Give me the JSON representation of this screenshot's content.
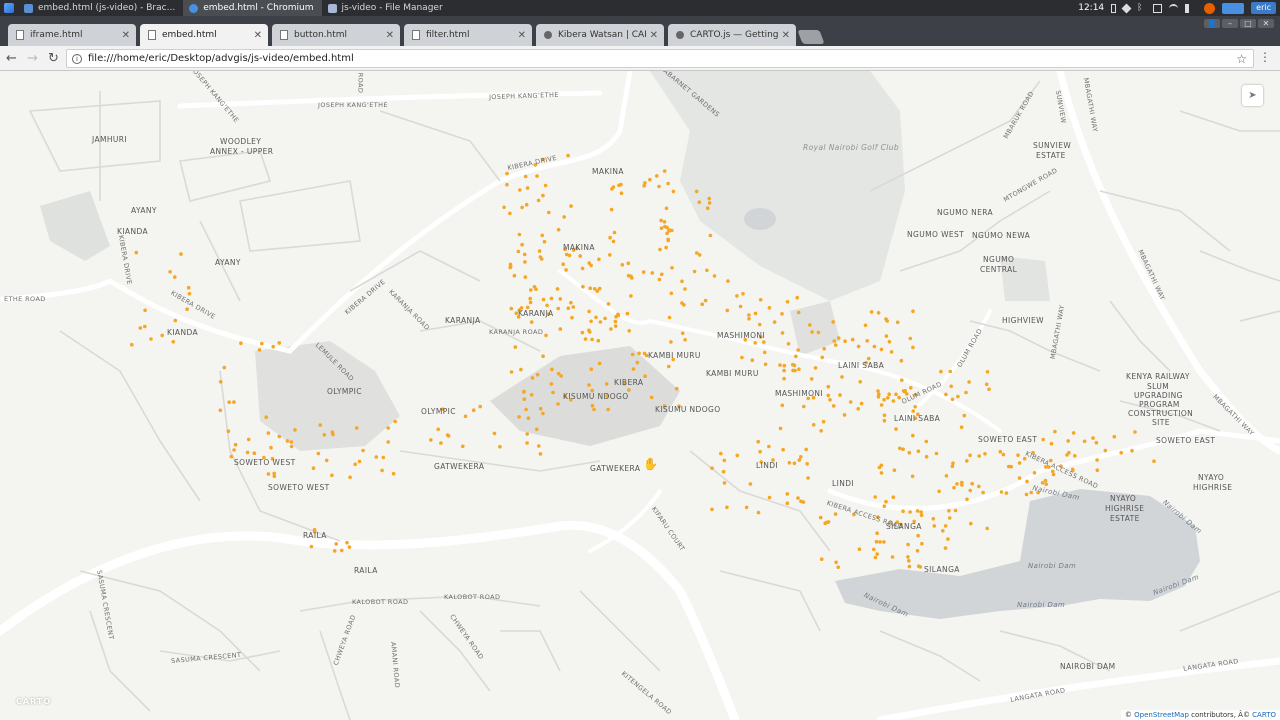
{
  "taskbar": {
    "tasks": [
      {
        "label": "embed.html (js-video) - Brac...",
        "active": false,
        "color": "#5a8fd6"
      },
      {
        "label": "embed.html - Chromium",
        "active": true,
        "color": "#4a90e2"
      },
      {
        "label": "js-video - File Manager",
        "active": false,
        "color": "#a7b7d6"
      }
    ],
    "clock": "12:14",
    "user": "eric"
  },
  "browser": {
    "tabs": [
      {
        "title": "iframe.html",
        "icon": "page-icon",
        "active": false
      },
      {
        "title": "embed.html",
        "icon": "page-icon",
        "active": true
      },
      {
        "title": "button.html",
        "icon": "page-icon",
        "active": false
      },
      {
        "title": "filter.html",
        "icon": "page-icon",
        "active": false
      },
      {
        "title": "Kibera Watsan | CARTO",
        "icon": "carto-icon",
        "active": false
      },
      {
        "title": "CARTO.js — Getting sta",
        "icon": "carto-icon",
        "active": false
      }
    ],
    "url": "file:///home/eric/Desktop/advgis/js-video/embed.html"
  },
  "map": {
    "point_color": "#f5a623",
    "labels": {
      "jamhuri": "JAMHURI",
      "woodley1": "WOODLEY",
      "woodley2": "ANNEX - UPPER",
      "ayany1": "AYANY",
      "ayany2": "AYANY",
      "kianda1": "KIANDA",
      "kianda2": "KIANDA",
      "makina1": "MAKINA",
      "makina2": "MAKINA",
      "karanja1": "KARANJA",
      "karanja2": "KARANJA",
      "olympic1": "OLYMPIC",
      "olympic2": "OLYMPIC",
      "kibera": "KIBERA",
      "kisumu1": "KISUMU NDOGO",
      "kisumu2": "KISUMU NDOGO",
      "kambi1": "KAMBI MURU",
      "kambi2": "KAMBI MURU",
      "mashimoni1": "MASHIMONI",
      "mashimoni2": "MASHIMONI",
      "lainisaba1": "LAINI SABA",
      "lainisaba2": "LAINI SABA",
      "soweto_w1": "SOWETO WEST",
      "soweto_w2": "SOWETO WEST",
      "gatwekera1": "GATWEKERA",
      "gatwekera2": "GATWEKERA",
      "lindi1": "LINDI",
      "lindi2": "LINDI",
      "silanga1": "SILANGA",
      "silanga2": "SILANGA",
      "raila1": "RAILA",
      "raila2": "RAILA",
      "soweto_e1": "SOWETO EAST",
      "soweto_e2": "SOWETO EAST",
      "ngumo_nera": "NGUMO NERA",
      "ngumo_west": "NGUMO WEST",
      "ngumo_newa": "NGUMO NEWA",
      "ngumo_central1": "NGUMO",
      "ngumo_central2": "CENTRAL",
      "highview": "HIGHVIEW",
      "sunview1": "SUNVIEW",
      "sunview2": "ESTATE",
      "kenya_rail1": "KENYA RAILWAY",
      "kenya_rail2": "SLUM",
      "kenya_rail3": "UPGRADING",
      "kenya_rail4": "PROGRAM",
      "kenya_rail5": "CONSTRUCTION",
      "kenya_rail6": "SITE",
      "nyayo1": "NYAYO",
      "nyayo2": "HIGHRISE",
      "nyayo_e1": "NYAYO",
      "nyayo_e2": "HIGHRISE",
      "nyayo_e3": "ESTATE",
      "nairobi_dam_area": "NAIROBI DAM",
      "golf": "Royal Nairobi Golf Club",
      "dam1": "Nairobi Dam",
      "dam2": "Nairobi Dam",
      "dam3": "Nairobi Dam",
      "dam4": "Nairobi Dam",
      "dam5": "Nairobi Dam",
      "dam6": "Nairobi Dam",
      "joseph1": "JOSEPH KANG'ETHE",
      "joseph2": "JOSEPH KANG'ETHE",
      "joseph3": "JOSEPH KANG'ETHE",
      "kibera_drive1": "KIBERA DRIVE",
      "kibera_drive2": "KIBERA DRIVE",
      "kibera_drive3": "KIBERA DRIVE",
      "kibera_drive4": "KIBERA DRIVE",
      "karanja_road1": "KARANJA ROAD",
      "karanja_road2": "KARANJA ROAD",
      "lemule": "LEMULE ROAD",
      "kibera_access": "KIBERA ACCESS ROAD",
      "kibera_access2": "KIBERA ACCESS ROAD",
      "kifaru": "KIFARU COURT",
      "olum": "OLUM ROAD",
      "olum2": "OLUM ROAD",
      "mbagathi1": "MBAGATHI WAY",
      "mbagathi2": "MBAGATHI WAY",
      "mbagathi3": "MBAGATHI WAY",
      "mbagathi4": "MBAGATHI WAY",
      "kalobot1": "KALOBOT ROAD",
      "kalobot2": "KALOBOT ROAD",
      "sasuma_cres1": "SASUMA CRESCENT",
      "sasuma_cres2": "SASUMA CRESCENT",
      "chweya1": "CHWEYA ROAD",
      "chweya2": "CHWEYA ROAD",
      "amani": "AMANI ROAD",
      "kitengela": "KITENGELA ROAD",
      "langata1": "LANGATA ROAD",
      "langata2": "LANGATA ROAD",
      "the_road": "ETHE ROAD",
      "abarnet": "ABARNET GARDENS",
      "mbaruk": "MBARUK ROAD",
      "sunview_road": "SUNVIEW",
      "mtongwe": "MTONGWE ROAD",
      "road_top": "ROAD"
    },
    "carto_logo": "CARTO",
    "attribution": {
      "prefix": "© ",
      "osm": "OpenStreetMap",
      "middle": " contributors, Â© ",
      "carto": "CARTO"
    }
  }
}
